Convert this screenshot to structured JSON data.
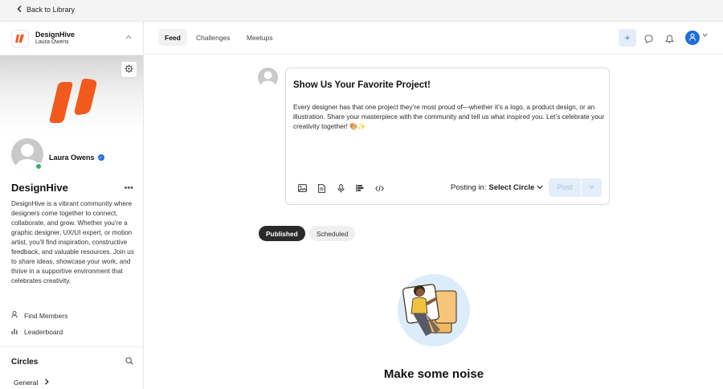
{
  "topbar": {
    "back_label": "Back to Library"
  },
  "community": {
    "name": "DesignHive",
    "owner": "Laura Owens",
    "title": "DesignHive",
    "description": "DesignHive is a vibrant community where designers come together to connect, collaborate, and grow. Whether you’re a graphic designer, UX/UI expert, or motion artist, you’ll find inspiration, constructive feedback, and valuable resources. Join us to share ideas, showcase your work, and thrive in a supportive environment that celebrates creativity.",
    "brand_color": "#f25a1d"
  },
  "sidebar": {
    "links": [
      {
        "label": "Find Members",
        "icon": "person-icon"
      },
      {
        "label": "Leaderboard",
        "icon": "bar-chart-icon"
      }
    ],
    "circles_title": "Circles",
    "circles": [
      {
        "label": "General"
      }
    ]
  },
  "header": {
    "tabs": [
      {
        "label": "Feed",
        "active": true
      },
      {
        "label": "Challenges",
        "active": false
      },
      {
        "label": "Meetups",
        "active": false
      }
    ],
    "accent": "#1f6fd6"
  },
  "composer": {
    "title": "Show Us Your Favorite Project!",
    "body": "Every designer has that one project they’re most proud of—whether it’s a logo, a product design, or an illustration. Share your masterpiece with the community and tell us what inspired you. Let’s celebrate your creativity together! 🎨✨",
    "posting_in_label": "Posting in:",
    "posting_in_value": "Select Circle",
    "post_label": "Post",
    "tools": [
      "image-icon",
      "document-icon",
      "microphone-icon",
      "poll-icon",
      "code-icon"
    ]
  },
  "filters": {
    "published": "Published",
    "scheduled": "Scheduled"
  },
  "empty_state": {
    "title": "Make some noise"
  }
}
